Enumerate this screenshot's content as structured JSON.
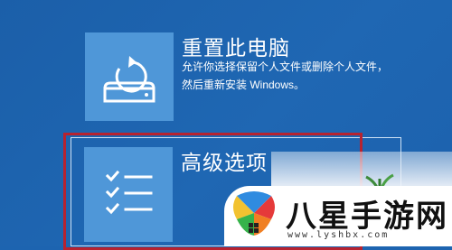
{
  "options": [
    {
      "id": "reset",
      "title": "重置此电脑",
      "description": "允许你选择保留个人文件或删除个人文件，然后重新安装 Windows。",
      "icon": "reset-pc-icon"
    },
    {
      "id": "advanced",
      "title": "高级选项",
      "description": "",
      "icon": "checklist-icon"
    }
  ],
  "watermark": {
    "brand": "八星手游网",
    "url": "www.lyshbx.com"
  },
  "colors": {
    "background": "#1d64b0",
    "tile": "#4f97d8",
    "highlight_frame": "#b72330"
  }
}
